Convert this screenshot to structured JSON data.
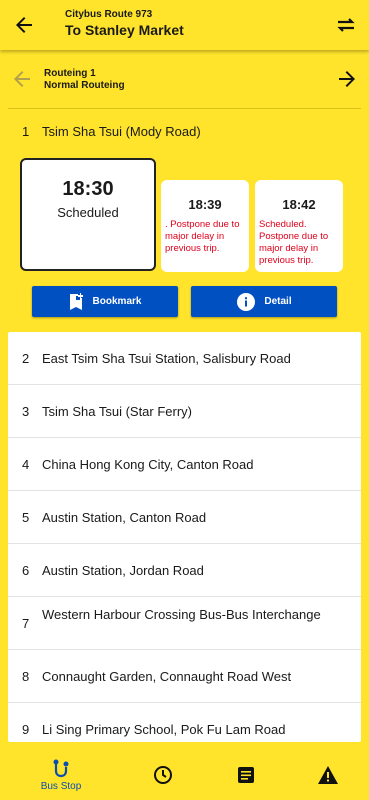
{
  "header": {
    "route_label": "Citybus Route 973",
    "destination": "To Stanley Market"
  },
  "routeing": {
    "name": "Routeing 1",
    "type": "Normal Routeing"
  },
  "selected_stop": {
    "number": "1",
    "name": "Tsim Sha Tsui (Mody Road)",
    "etas": [
      {
        "time": "18:30",
        "remark": "Scheduled"
      },
      {
        "time": "18:39",
        "remark": ". Postpone due to major delay in previous trip."
      },
      {
        "time": "18:42",
        "remark": "Scheduled. Postpone due to major delay in previous trip."
      }
    ],
    "bookmark_label": "Bookmark",
    "detail_label": "Detail"
  },
  "stops": [
    {
      "number": "2",
      "name": "East Tsim Sha Tsui Station, Salisbury Road"
    },
    {
      "number": "3",
      "name": "Tsim Sha Tsui (Star Ferry)"
    },
    {
      "number": "4",
      "name": "China Hong Kong City, Canton Road"
    },
    {
      "number": "5",
      "name": "Austin Station, Canton Road"
    },
    {
      "number": "6",
      "name": "Austin Station, Jordan Road"
    },
    {
      "number": "7",
      "name": "Western Harbour Crossing Bus-Bus Interchange"
    },
    {
      "number": "8",
      "name": "Connaught Garden, Connaught Road West"
    },
    {
      "number": "9",
      "name": "Li Sing Primary School, Pok Fu Lam Road"
    }
  ],
  "bottom_nav": {
    "bus_stop_label": "Bus Stop",
    "active_color": "#0a4fae"
  },
  "colors": {
    "background": "#FFE42B",
    "button": "#0050c2",
    "remark": "#e0001b"
  }
}
